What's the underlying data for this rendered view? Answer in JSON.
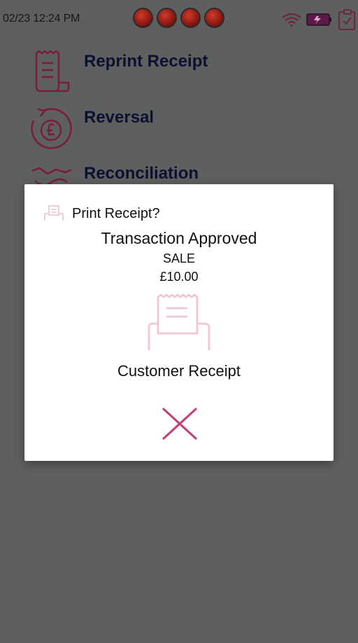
{
  "status_bar": {
    "datetime": "02/23 12:24 PM",
    "leds": [
      "led-1",
      "led-2",
      "led-3",
      "led-4"
    ],
    "icons": [
      "wifi-icon",
      "battery-charging-icon",
      "checklist-icon"
    ]
  },
  "menu": {
    "items": [
      {
        "label": "Reprint Receipt",
        "icon": "receipt-icon"
      },
      {
        "label": "Reversal",
        "icon": "pound-reverse-icon"
      },
      {
        "label": "Reconciliation",
        "icon": "handshake-icon"
      }
    ]
  },
  "dialog": {
    "title": "Print Receipt?",
    "status": "Transaction Approved",
    "type": "SALE",
    "amount": "£10.00",
    "receipt_label": "Customer Receipt",
    "close_icon": "close-icon"
  },
  "colors": {
    "accent": "#c2427c",
    "accent_light": "#efc6d6",
    "menu_icon": "#7a1c3c",
    "menu_text": "#0c1130",
    "overlay": "#5e6060"
  }
}
